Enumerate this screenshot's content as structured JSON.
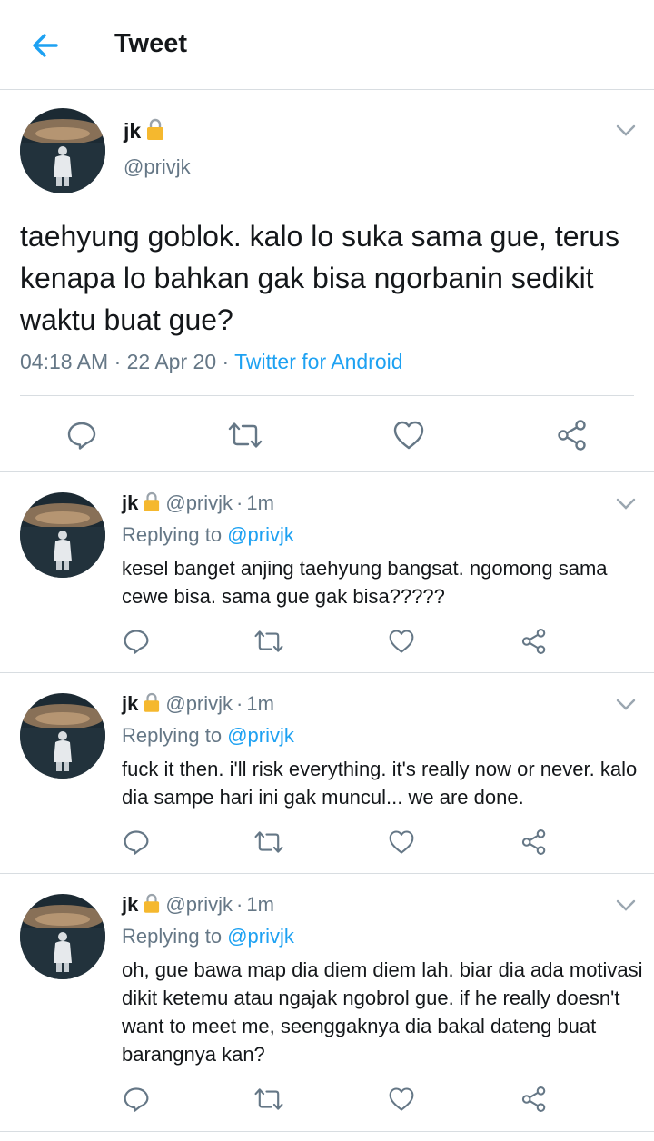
{
  "header": {
    "title": "Tweet",
    "back_icon": "back-arrow-icon",
    "accent": "#1da1f2"
  },
  "main_tweet": {
    "name": "jk",
    "lock_icon": "lock-icon",
    "handle": "@privjk",
    "text": "taehyung goblok. kalo lo suka sama gue, terus kenapa lo bahkan gak bisa ngorbanin sedikit waktu buat gue?",
    "time": "04:18 AM",
    "date": "22 Apr 20",
    "source": "Twitter for Android",
    "sep": "·"
  },
  "replies": [
    {
      "name": "jk",
      "handle": "@privjk",
      "time": "1m",
      "replying_label": "Replying to",
      "replying_to": "@privjk",
      "text": "kesel banget anjing taehyung bangsat. ngomong sama cewe bisa. sama gue gak bisa?????"
    },
    {
      "name": "jk",
      "handle": "@privjk",
      "time": "1m",
      "replying_label": "Replying to",
      "replying_to": "@privjk",
      "text": "fuck it then. i'll risk everything. it's really now or never. kalo dia sampe hari ini gak muncul... we are done."
    },
    {
      "name": "jk",
      "handle": "@privjk",
      "time": "1m",
      "replying_label": "Replying to",
      "replying_to": "@privjk",
      "text": "oh, gue bawa map dia diem diem lah. biar dia ada motivasi dikit ketemu atau ngajak ngobrol gue. if he really doesn't want to meet me, seenggaknya dia bakal dateng buat barangnya kan?"
    }
  ],
  "icons": [
    "reply-icon",
    "retweet-icon",
    "like-icon",
    "share-icon",
    "chevron-down-icon"
  ],
  "colors": {
    "text": "#14171a",
    "secondary": "#657786",
    "divider": "#d8dde1",
    "link": "#1da1f2"
  }
}
